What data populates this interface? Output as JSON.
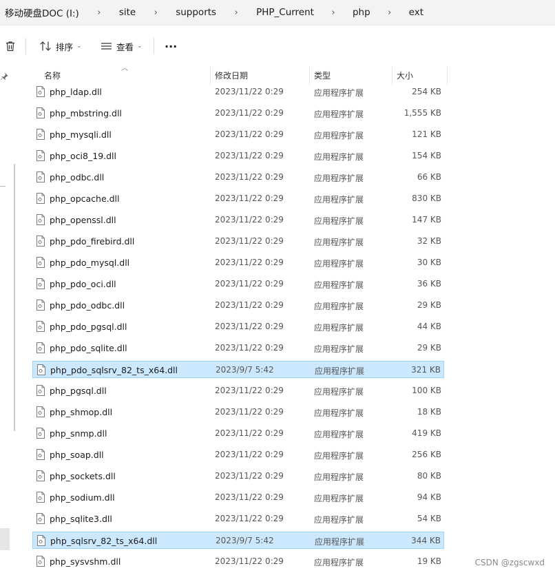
{
  "breadcrumb": [
    "移动硬盘DOC (I:)",
    "site",
    "supports",
    "PHP_Current",
    "php",
    "ext"
  ],
  "toolbar": {
    "delete_icon": "trash-icon",
    "sort_label": "排序",
    "view_label": "查看",
    "more_label": "···"
  },
  "columns": {
    "name": "名称",
    "date": "修改日期",
    "type": "类型",
    "size": "大小"
  },
  "files": [
    {
      "name": "php_ldap.dll",
      "date": "2023/11/22 0:29",
      "type": "应用程序扩展",
      "size": "254 KB",
      "selected": false
    },
    {
      "name": "php_mbstring.dll",
      "date": "2023/11/22 0:29",
      "type": "应用程序扩展",
      "size": "1,555 KB",
      "selected": false
    },
    {
      "name": "php_mysqli.dll",
      "date": "2023/11/22 0:29",
      "type": "应用程序扩展",
      "size": "121 KB",
      "selected": false
    },
    {
      "name": "php_oci8_19.dll",
      "date": "2023/11/22 0:29",
      "type": "应用程序扩展",
      "size": "154 KB",
      "selected": false
    },
    {
      "name": "php_odbc.dll",
      "date": "2023/11/22 0:29",
      "type": "应用程序扩展",
      "size": "66 KB",
      "selected": false
    },
    {
      "name": "php_opcache.dll",
      "date": "2023/11/22 0:29",
      "type": "应用程序扩展",
      "size": "830 KB",
      "selected": false
    },
    {
      "name": "php_openssl.dll",
      "date": "2023/11/22 0:29",
      "type": "应用程序扩展",
      "size": "147 KB",
      "selected": false
    },
    {
      "name": "php_pdo_firebird.dll",
      "date": "2023/11/22 0:29",
      "type": "应用程序扩展",
      "size": "32 KB",
      "selected": false
    },
    {
      "name": "php_pdo_mysql.dll",
      "date": "2023/11/22 0:29",
      "type": "应用程序扩展",
      "size": "30 KB",
      "selected": false
    },
    {
      "name": "php_pdo_oci.dll",
      "date": "2023/11/22 0:29",
      "type": "应用程序扩展",
      "size": "36 KB",
      "selected": false
    },
    {
      "name": "php_pdo_odbc.dll",
      "date": "2023/11/22 0:29",
      "type": "应用程序扩展",
      "size": "29 KB",
      "selected": false
    },
    {
      "name": "php_pdo_pgsql.dll",
      "date": "2023/11/22 0:29",
      "type": "应用程序扩展",
      "size": "44 KB",
      "selected": false
    },
    {
      "name": "php_pdo_sqlite.dll",
      "date": "2023/11/22 0:29",
      "type": "应用程序扩展",
      "size": "29 KB",
      "selected": false
    },
    {
      "name": "php_pdo_sqlsrv_82_ts_x64.dll",
      "date": "2023/9/7 5:42",
      "type": "应用程序扩展",
      "size": "321 KB",
      "selected": true
    },
    {
      "name": "php_pgsql.dll",
      "date": "2023/11/22 0:29",
      "type": "应用程序扩展",
      "size": "100 KB",
      "selected": false
    },
    {
      "name": "php_shmop.dll",
      "date": "2023/11/22 0:29",
      "type": "应用程序扩展",
      "size": "18 KB",
      "selected": false
    },
    {
      "name": "php_snmp.dll",
      "date": "2023/11/22 0:29",
      "type": "应用程序扩展",
      "size": "419 KB",
      "selected": false
    },
    {
      "name": "php_soap.dll",
      "date": "2023/11/22 0:29",
      "type": "应用程序扩展",
      "size": "256 KB",
      "selected": false
    },
    {
      "name": "php_sockets.dll",
      "date": "2023/11/22 0:29",
      "type": "应用程序扩展",
      "size": "80 KB",
      "selected": false
    },
    {
      "name": "php_sodium.dll",
      "date": "2023/11/22 0:29",
      "type": "应用程序扩展",
      "size": "94 KB",
      "selected": false
    },
    {
      "name": "php_sqlite3.dll",
      "date": "2023/11/22 0:29",
      "type": "应用程序扩展",
      "size": "54 KB",
      "selected": false
    },
    {
      "name": "php_sqlsrv_82_ts_x64.dll",
      "date": "2023/9/7 5:42",
      "type": "应用程序扩展",
      "size": "344 KB",
      "selected": true
    },
    {
      "name": "php_sysvshm.dll",
      "date": "2023/11/22 0:29",
      "type": "应用程序扩展",
      "size": "19 KB",
      "selected": false
    }
  ],
  "watermark": "CSDN @zgscwxd",
  "colors": {
    "selected_bg": "#cce8ff",
    "selected_border": "#99d1ff",
    "breadcrumb_bg": "#f3f3f3"
  }
}
